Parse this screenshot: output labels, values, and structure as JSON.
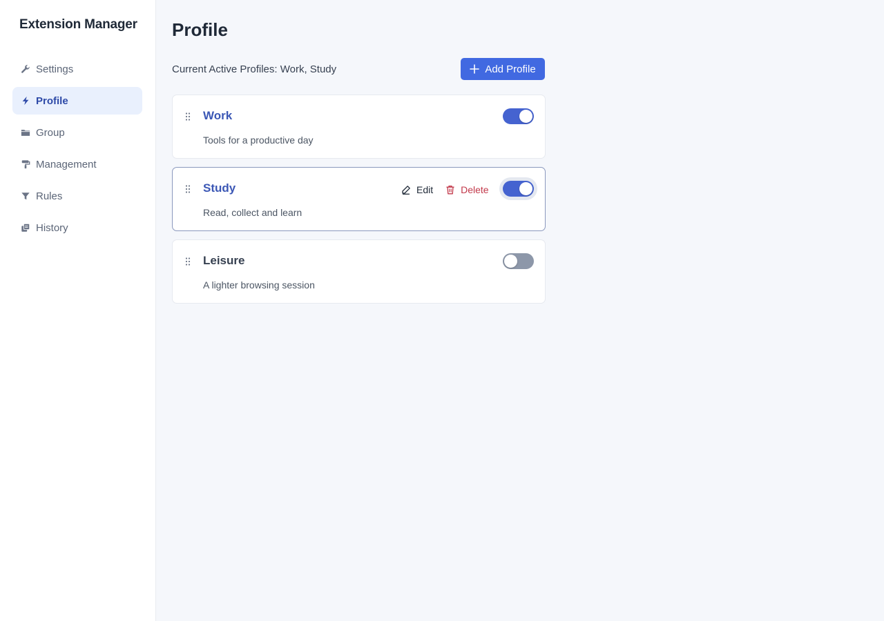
{
  "app": {
    "title": "Extension Manager"
  },
  "sidebar": {
    "items": [
      {
        "label": "Settings",
        "icon": "wrench-icon",
        "active": false
      },
      {
        "label": "Profile",
        "icon": "bolt-icon",
        "active": true
      },
      {
        "label": "Group",
        "icon": "folder-icon",
        "active": false
      },
      {
        "label": "Management",
        "icon": "paint-roller-icon",
        "active": false
      },
      {
        "label": "Rules",
        "icon": "filter-icon",
        "active": false
      },
      {
        "label": "History",
        "icon": "history-icon",
        "active": false
      }
    ]
  },
  "main": {
    "title": "Profile",
    "active_profiles_text": "Current Active Profiles: Work, Study",
    "add_button_label": "Add Profile",
    "profiles": [
      {
        "name": "Work",
        "description": "Tools for a productive day",
        "enabled": true
      },
      {
        "name": "Study",
        "description": "Read, collect and learn",
        "enabled": true,
        "edit_label": "Edit",
        "delete_label": "Delete"
      },
      {
        "name": "Leisure",
        "description": "A lighter browsing session",
        "enabled": false
      }
    ]
  },
  "colors": {
    "accent": "#4169e1",
    "toggle_on": "#4563d0",
    "toggle_off": "#8d97a9",
    "active_nav_bg": "#e9f0fd",
    "delete": "#c2384a"
  }
}
